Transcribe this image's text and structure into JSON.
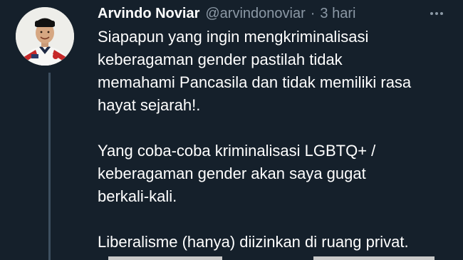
{
  "tweet": {
    "author_name": "Arvindo Noviar",
    "handle": "@arvindonoviar",
    "separator": "·",
    "time": "3 hari",
    "more_icon": "more-horizontal-icon",
    "paragraphs": [
      {
        "lines": [
          "Siapapun yang ingin mengkriminalisasi",
          "keberagaman gender pastilah tidak",
          "memahami Pancasila dan tidak memiliki rasa",
          "hayat sejarah!."
        ]
      },
      {
        "lines": [
          "Yang coba-coba kriminalisasi LGBTQ+ /",
          "keberagaman gender akan saya gugat",
          "berkali-kali."
        ]
      },
      {
        "lines": [
          "Liberalisme (hanya) diizinkan di ruang privat."
        ]
      }
    ]
  },
  "colors": {
    "background": "#15202b",
    "text": "#ffffff",
    "secondary_text": "#8b98a5",
    "thread_line": "#3d4f60"
  }
}
